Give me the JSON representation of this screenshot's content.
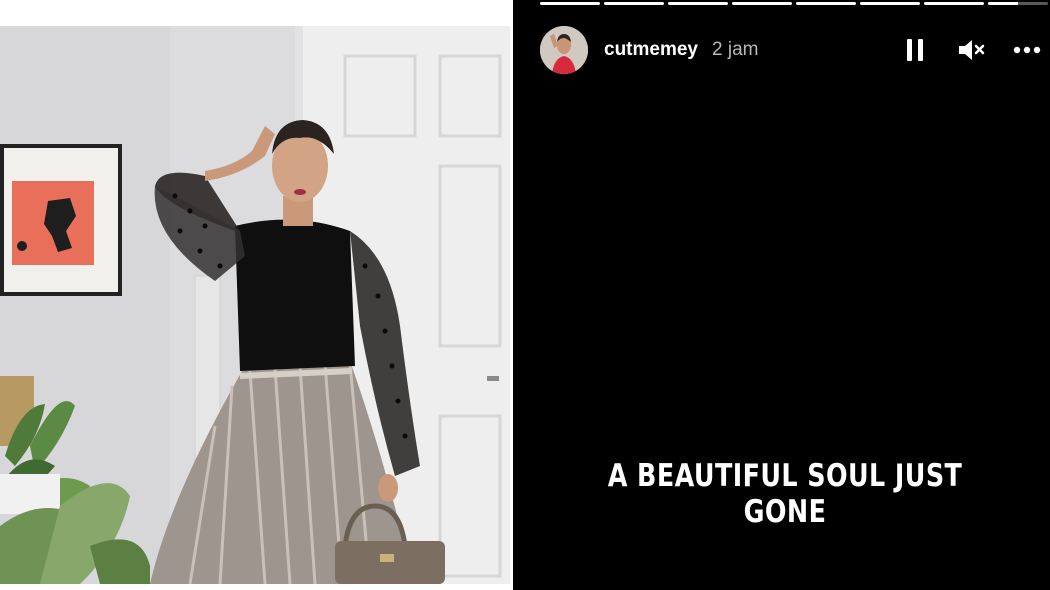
{
  "story": {
    "username": "cutmemey",
    "timestamp": "2 jam",
    "caption": "A BEAUTIFUL SOUL JUST GONE",
    "progress_segments": [
      1,
      1,
      1,
      1,
      1,
      1,
      1,
      0.5
    ],
    "icons": {
      "pause": "pause-icon",
      "mute": "mute-icon",
      "more": "more-options-icon"
    }
  },
  "colors": {
    "story_background": "#000000",
    "text_primary": "#ffffff",
    "text_secondary": "#b8b8b8"
  }
}
